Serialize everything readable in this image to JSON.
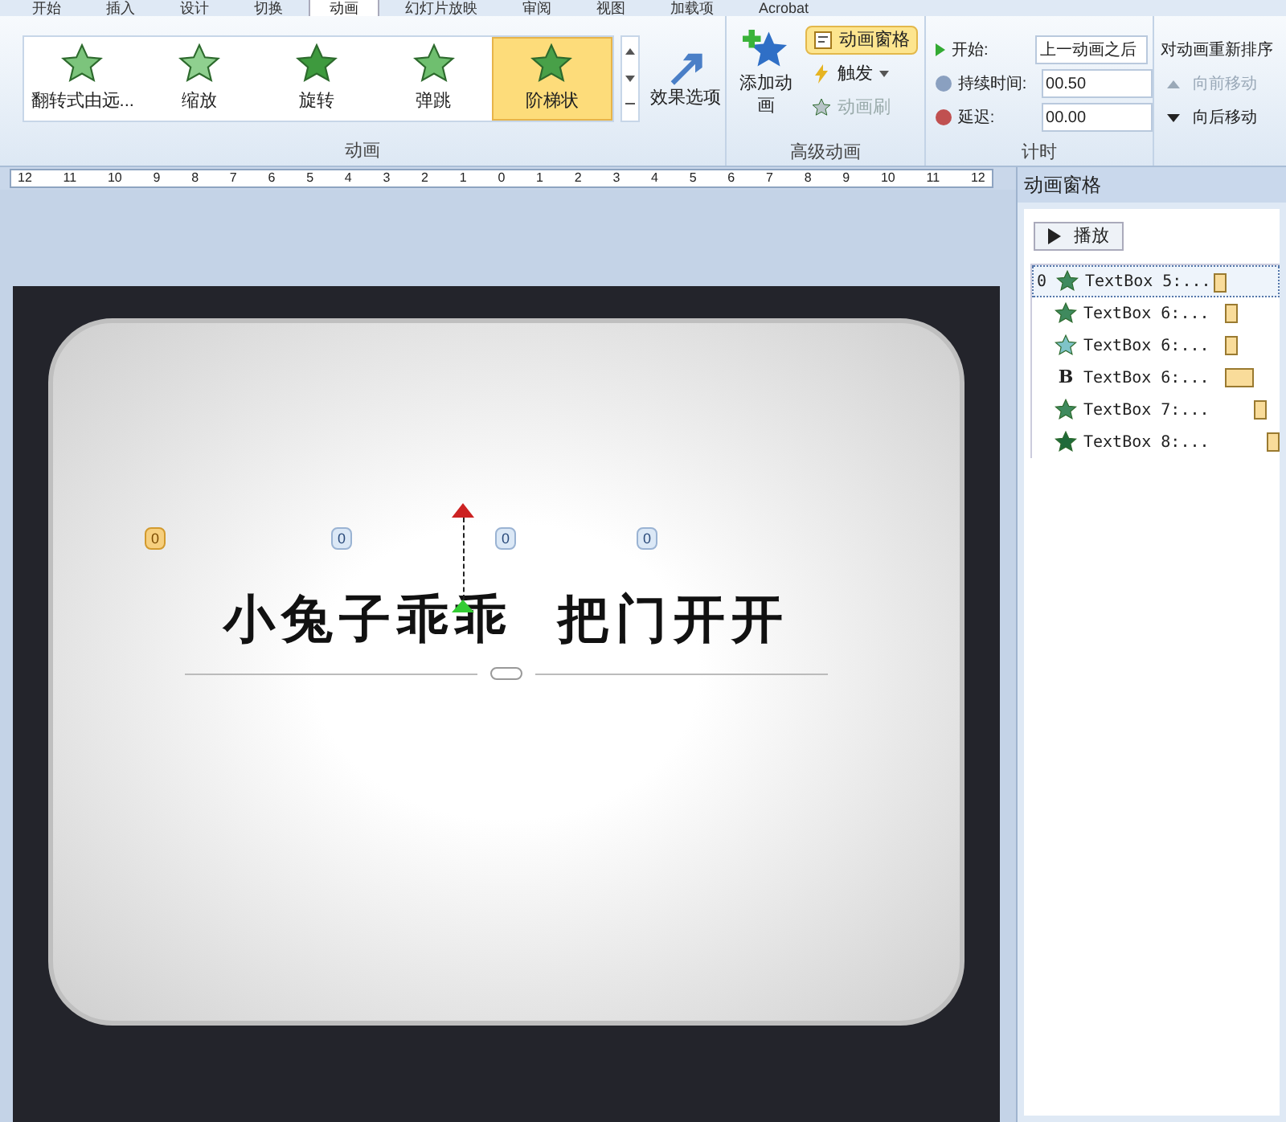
{
  "tabs": [
    {
      "label": "开始",
      "selected": false
    },
    {
      "label": "插入",
      "selected": false
    },
    {
      "label": "设计",
      "selected": false
    },
    {
      "label": "切换",
      "selected": false
    },
    {
      "label": "动画",
      "selected": true
    },
    {
      "label": "幻灯片放映",
      "selected": false
    },
    {
      "label": "审阅",
      "selected": false
    },
    {
      "label": "视图",
      "selected": false
    },
    {
      "label": "加载项",
      "selected": false
    },
    {
      "label": "Acrobat",
      "selected": false
    }
  ],
  "animation_gallery": {
    "items": [
      {
        "label": "翻转式由远...",
        "kind": "flip",
        "selected": false
      },
      {
        "label": "缩放",
        "kind": "zoom",
        "selected": false
      },
      {
        "label": "旋转",
        "kind": "spin",
        "selected": false
      },
      {
        "label": "弹跳",
        "kind": "bounce",
        "selected": false
      },
      {
        "label": "阶梯状",
        "kind": "star",
        "selected": true
      }
    ],
    "effect_options": "效果选项",
    "group_label": "动画"
  },
  "advanced": {
    "add_animation": "添加动画",
    "pane_button": {
      "label": "动画窗格",
      "selected": true
    },
    "trigger": "触发",
    "painter": {
      "label": "动画刷",
      "disabled": true
    },
    "group_label": "高级动画"
  },
  "timing": {
    "start_label": "开始:",
    "start_value": "上一动画之后",
    "duration_label": "持续时间:",
    "duration_value": "00.50",
    "delay_label": "延迟:",
    "delay_value": "00.00",
    "group_label": "计时"
  },
  "reorder": {
    "title": "对动画重新排序",
    "move_earlier": {
      "label": "向前移动",
      "disabled": true
    },
    "move_later": {
      "label": "向后移动",
      "disabled": false
    }
  },
  "ruler": [
    "12",
    "11",
    "10",
    "9",
    "8",
    "7",
    "6",
    "5",
    "4",
    "3",
    "2",
    "1",
    "0",
    "1",
    "2",
    "3",
    "4",
    "5",
    "6",
    "7",
    "8",
    "9",
    "10",
    "11",
    "12"
  ],
  "slide": {
    "title_left": "小兔子乖乖",
    "title_right": "把门开开",
    "badges": [
      {
        "label": "0",
        "selected": true
      },
      {
        "label": "0",
        "selected": false
      },
      {
        "label": "0",
        "selected": false
      },
      {
        "label": "0",
        "selected": false
      }
    ]
  },
  "animation_pane": {
    "title": "动画窗格",
    "play": "播放",
    "items": [
      {
        "number": "0",
        "label": "TextBox 5:...",
        "kind": "star",
        "selected": true
      },
      {
        "label": "TextBox 6:...",
        "kind": "star",
        "selected": false
      },
      {
        "label": "TextBox 6:...",
        "kind": "sparkle",
        "selected": false
      },
      {
        "label": "TextBox 6:...",
        "kind": "bold",
        "icon": "B",
        "selected": false
      },
      {
        "label": "TextBox 7:...",
        "kind": "star",
        "selected": false
      },
      {
        "label": "TextBox 8:...",
        "kind": "solid",
        "selected": false
      }
    ]
  }
}
